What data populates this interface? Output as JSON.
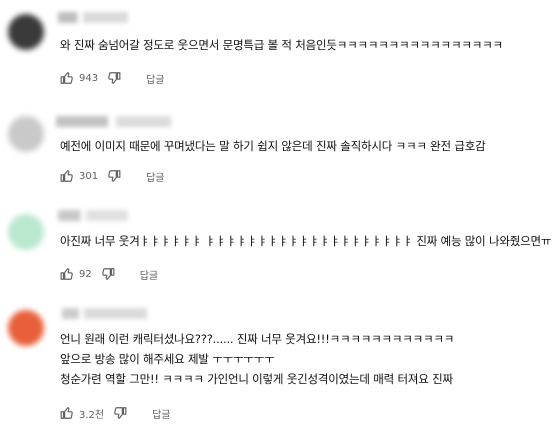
{
  "comments": [
    {
      "avatar_color": "#3a3a3a",
      "lines": [
        "와 진짜 숨넘어갈 정도로 웃으면서 문명특급 볼 적 처음인듯ㅋㅋㅋㅋㅋㅋㅋㅋㅋㅋㅋㅋㅋㅋㅋㅋ"
      ],
      "like_count": "943",
      "reply_label": "답글"
    },
    {
      "avatar_color": "#c9c9c9",
      "lines": [
        "예전에 이미지 때문에 꾸며냈다는 말 하기 쉽지 않은데 진짜 솔직하시다 ㅋㅋㅋ 완전 급호감"
      ],
      "like_count": "301",
      "reply_label": "답글"
    },
    {
      "avatar_color": "#b9e8cf",
      "lines": [
        "아진짜 너무 웃겨ㅑㅑㅑㅑㅑㅑ ㅑㅑㅑㅑㅑㅑㅑㅑㅑㅑㅑㅑㅑㅑㅑㅑㅑㅑㅑㅑ 진짜 예능 많이 나와줬으면ㅠ"
      ],
      "like_count": "92",
      "reply_label": "답글"
    },
    {
      "avatar_color": "#e8603a",
      "lines": [
        "언니 원래 이런 캐릭터셨나요???...... 진짜 너무 웃겨요!!!ㅋㅋㅋㅋㅋㅋㅋㅋㅋㅋㅋㅋ",
        "앞으로 방송 많이 해주세요 제발 ㅜㅜㅜㅜㅜㅜ",
        "청순가련 역할 그만!! ㅋㅋㅋㅋ 가인언니 이렇게 웃긴성격이였는데 매력 터져요 진짜"
      ],
      "like_count": "3.2천",
      "reply_label": "답글"
    }
  ],
  "icons": {
    "like": "thumbs-up-icon",
    "dislike": "thumbs-down-icon"
  }
}
